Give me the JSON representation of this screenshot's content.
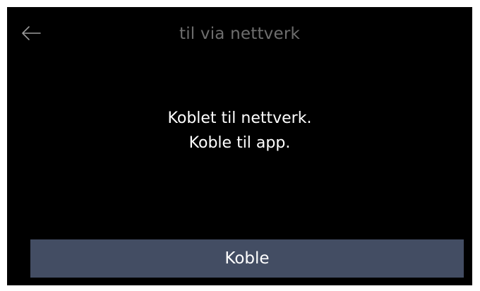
{
  "header": {
    "title": "til via nettverk",
    "back_icon": "arrow-left-icon"
  },
  "message": {
    "line1": "Koblet til nettverk.",
    "line2": "Koble til app."
  },
  "actions": {
    "connect_label": "Koble"
  },
  "colors": {
    "background": "#000000",
    "title_text": "#6e6e6e",
    "body_text": "#ffffff",
    "button_bg": "#434d63"
  }
}
